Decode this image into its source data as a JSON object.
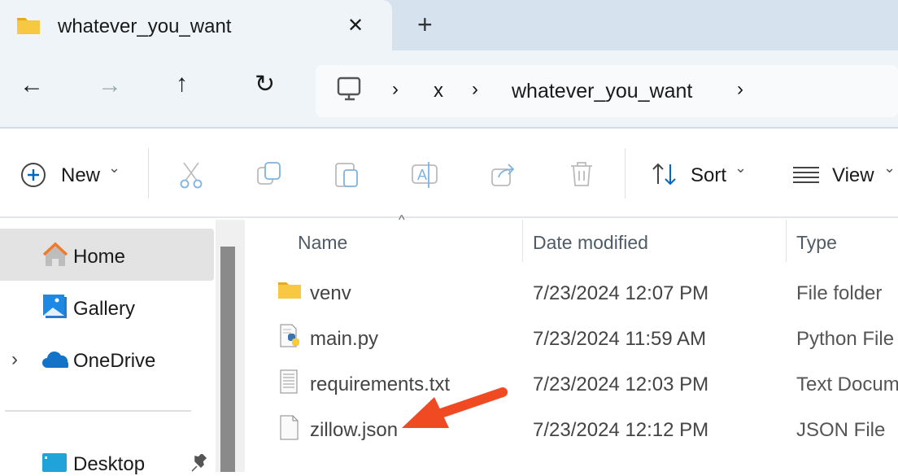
{
  "tab": {
    "title": "whatever_you_want",
    "close": "✕",
    "new_tab": "+"
  },
  "nav": {
    "back": "←",
    "forward": "→",
    "up": "↑",
    "refresh": "↻"
  },
  "breadcrumb": {
    "sep": "›",
    "items": [
      "x",
      "whatever_you_want"
    ]
  },
  "toolbar": {
    "new_label": "New",
    "sort_label": "Sort",
    "view_label": "View",
    "caret": "⌄"
  },
  "sidebar": {
    "items": [
      {
        "label": "Home",
        "selected": true
      },
      {
        "label": "Gallery"
      },
      {
        "label": "OneDrive",
        "expand": "›"
      },
      {
        "label": "Desktop",
        "pinned": true
      }
    ]
  },
  "columns": {
    "name": "Name",
    "date": "Date modified",
    "type": "Type",
    "sort_indicator": "^"
  },
  "files": [
    {
      "name": "venv",
      "date": "7/23/2024 12:07 PM",
      "type": "File folder",
      "icon": "folder-icon"
    },
    {
      "name": "main.py",
      "date": "7/23/2024 11:59 AM",
      "type": "Python File",
      "icon": "python-file-icon"
    },
    {
      "name": "requirements.txt",
      "date": "7/23/2024 12:03 PM",
      "type": "Text Docum",
      "icon": "text-file-icon"
    },
    {
      "name": "zillow.json",
      "date": "7/23/2024 12:12 PM",
      "type": "JSON File",
      "icon": "blank-file-icon"
    }
  ],
  "colors": {
    "accent": "#0067c0",
    "arrow": "#f04a23",
    "folder": "#f8c842"
  }
}
